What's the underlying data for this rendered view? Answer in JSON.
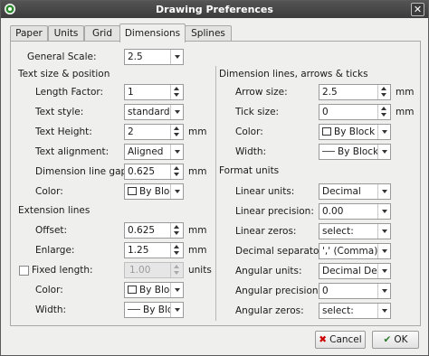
{
  "window": {
    "title": "Drawing Preferences"
  },
  "tabs": [
    "Paper",
    "Units",
    "Grid",
    "Dimensions",
    "Splines"
  ],
  "active_tab": "Dimensions",
  "general_scale": {
    "label": "General Scale:",
    "value": "2.5"
  },
  "text_section": {
    "heading": "Text size & position",
    "length_factor": {
      "label": "Length Factor:",
      "value": "1"
    },
    "text_style": {
      "label": "Text style:",
      "value": "standard"
    },
    "text_height": {
      "label": "Text Height:",
      "value": "2",
      "unit": "mm"
    },
    "text_alignment": {
      "label": "Text alignment:",
      "value": "Aligned"
    },
    "dim_line_gap": {
      "label": "Dimension line gap:",
      "value": "0.625",
      "unit": "mm"
    },
    "color": {
      "label": "Color:",
      "value": "By Bloc"
    }
  },
  "extension_section": {
    "heading": "Extension lines",
    "offset": {
      "label": "Offset:",
      "value": "0.625",
      "unit": "mm"
    },
    "enlarge": {
      "label": "Enlarge:",
      "value": "1.25",
      "unit": "mm"
    },
    "fixed_length": {
      "label": "Fixed length:",
      "value": "1.00",
      "unit": "units",
      "checked": false
    },
    "color": {
      "label": "Color:",
      "value": "By Bloc"
    },
    "width": {
      "label": "Width:",
      "value": "By Bloc"
    }
  },
  "dimlines_section": {
    "heading": "Dimension lines, arrows & ticks",
    "arrow_size": {
      "label": "Arrow size:",
      "value": "2.5",
      "unit": "mm"
    },
    "tick_size": {
      "label": "Tick size:",
      "value": "0",
      "unit": "mm"
    },
    "color": {
      "label": "Color:",
      "value": "By Block"
    },
    "width": {
      "label": "Width:",
      "value": "By Block"
    }
  },
  "format_section": {
    "heading": "Format units",
    "linear_units": {
      "label": "Linear units:",
      "value": "Decimal"
    },
    "linear_precision": {
      "label": "Linear precision:",
      "value": "0.00"
    },
    "linear_zeros": {
      "label": "Linear zeros:",
      "value": "select:"
    },
    "decimal_separator": {
      "label": "Decimal separator:",
      "value": "',' (Comma)"
    },
    "angular_units": {
      "label": "Angular units:",
      "value": "Decimal Degi"
    },
    "angular_precision": {
      "label": "Angular precision:",
      "value": "0"
    },
    "angular_zeros": {
      "label": "Angular zeros:",
      "value": "select:"
    }
  },
  "buttons": {
    "cancel": "Cancel",
    "ok": "OK"
  },
  "colors": {
    "titlebar": "#454545",
    "cancel_icon": "#cc0000",
    "ok_icon": "#2a7a2a",
    "app_icon": "#2d8a2d"
  }
}
